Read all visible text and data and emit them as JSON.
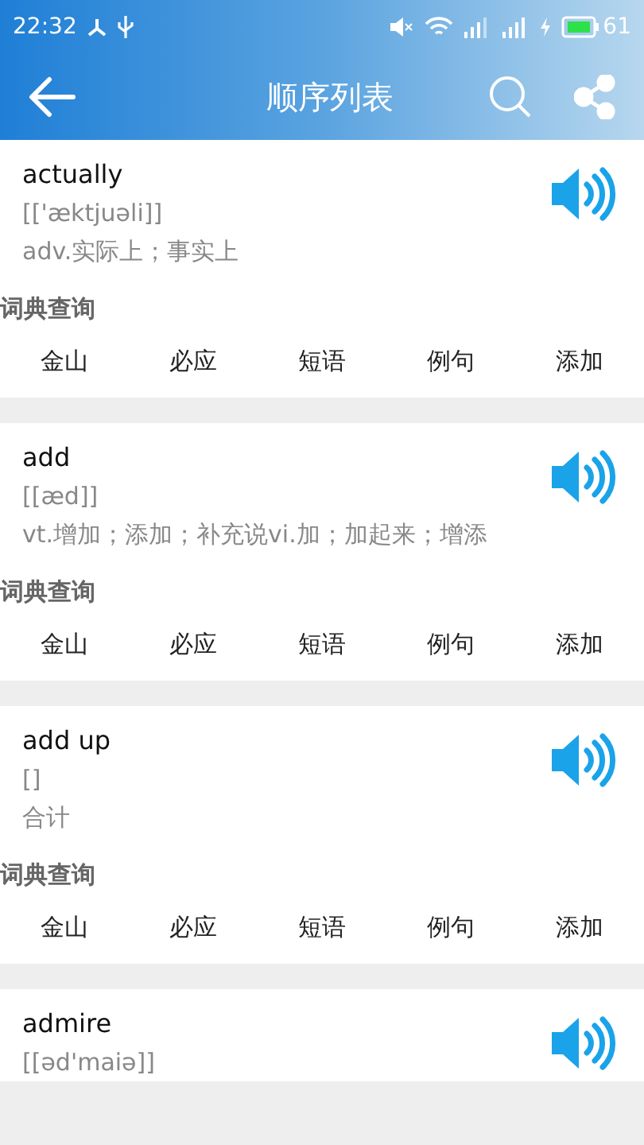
{
  "status_bar": {
    "time": "22:32",
    "battery": "61"
  },
  "toolbar": {
    "title": "顺序列表"
  },
  "entries": [
    {
      "word": "actually",
      "phonetic": "[['æktjuəli]]",
      "meaning": "adv.实际上；事实上",
      "section": "词典查询",
      "actions": [
        "金山",
        "必应",
        "短语",
        "例句",
        "添加"
      ]
    },
    {
      "word": "add",
      "phonetic": "[[æd]]",
      "meaning": "vt.增加；添加；补充说vi.加；加起来；增添",
      "section": "词典查询",
      "actions": [
        "金山",
        "必应",
        "短语",
        "例句",
        "添加"
      ]
    },
    {
      "word": "add up",
      "phonetic": "[]",
      "meaning": "合计",
      "section": "词典查询",
      "actions": [
        "金山",
        "必应",
        "短语",
        "例句",
        "添加"
      ]
    },
    {
      "word": "admire",
      "phonetic": "[[əd'maiə]]"
    }
  ]
}
